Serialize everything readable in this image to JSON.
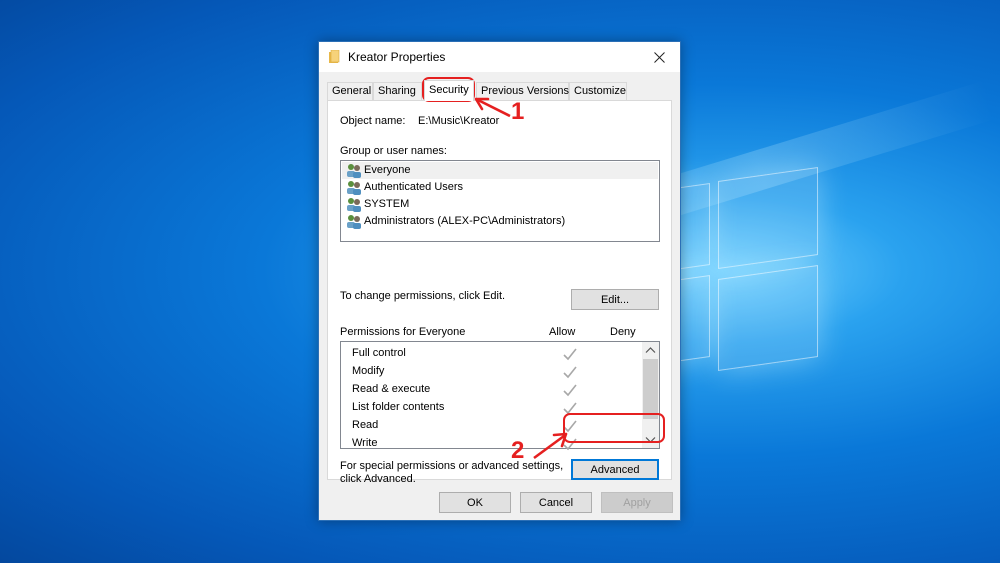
{
  "window": {
    "title": "Kreator Properties"
  },
  "tabs": [
    {
      "label": "General"
    },
    {
      "label": "Sharing"
    },
    {
      "label": "Security"
    },
    {
      "label": "Previous Versions"
    },
    {
      "label": "Customize"
    }
  ],
  "security": {
    "object_name_label": "Object name:",
    "object_name_value": "E:\\Music\\Kreator",
    "group_label": "Group or user names:",
    "users": [
      {
        "name": "Everyone"
      },
      {
        "name": "Authenticated Users"
      },
      {
        "name": "SYSTEM"
      },
      {
        "name": "Administrators (ALEX-PC\\Administrators)"
      }
    ],
    "change_hint": "To change permissions, click Edit.",
    "edit_label": "Edit...",
    "permissions_for": "Permissions for Everyone",
    "allow_label": "Allow",
    "deny_label": "Deny",
    "permissions": [
      {
        "name": "Full control"
      },
      {
        "name": "Modify"
      },
      {
        "name": "Read & execute"
      },
      {
        "name": "List folder contents"
      },
      {
        "name": "Read"
      },
      {
        "name": "Write"
      }
    ],
    "special_hint_line1": "For special permissions or advanced settings,",
    "special_hint_line2": "click Advanced.",
    "advanced_label": "Advanced"
  },
  "footer": {
    "ok_label": "OK",
    "cancel_label": "Cancel",
    "apply_label": "Apply"
  },
  "annotations": {
    "step1": "1",
    "step2": "2",
    "color": "#e52020"
  }
}
